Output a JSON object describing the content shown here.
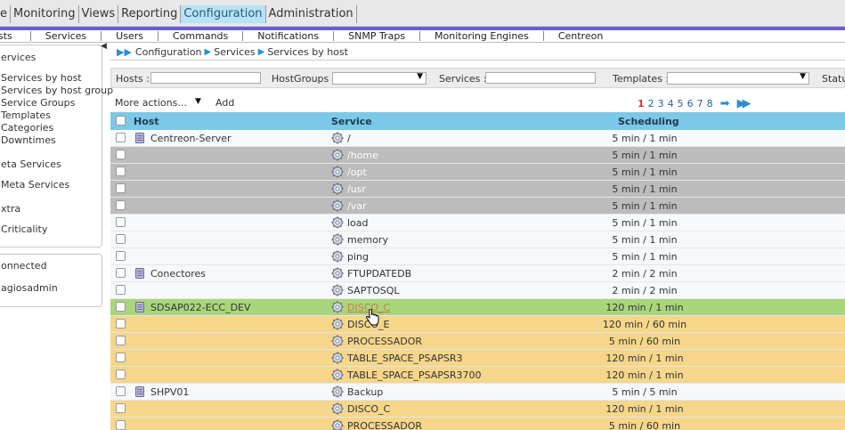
{
  "top_menu": [
    {
      "label": "e"
    },
    {
      "label": "Monitoring"
    },
    {
      "label": "Views"
    },
    {
      "label": "Reporting"
    },
    {
      "label": "Configuration",
      "active": true
    },
    {
      "label": "Administration"
    }
  ],
  "sub_menu": [
    "sts",
    "Services",
    "Users",
    "Commands",
    "Notifications",
    "SNMP Traps",
    "Monitoring Engines",
    "Centreon"
  ],
  "sidebar": {
    "section_title": "ervices",
    "items": [
      "Services by host",
      "Services by host group",
      "Service Groups",
      "Templates",
      "Categories",
      "Downtimes"
    ],
    "meta_title": "eta Services",
    "meta_item": "Meta Services",
    "extra_title": "xtra",
    "extra_item": "Criticality",
    "connected_label": "onnected",
    "user": "agiosadmin"
  },
  "breadcrumb": [
    "Configuration",
    "Services",
    "Services by host"
  ],
  "filters": {
    "hosts_label": "Hosts :",
    "hostgroups_label": "HostGroups :",
    "services_label": "Services :",
    "templates_label": "Templates :",
    "status_label": "Statu"
  },
  "actions": {
    "more_actions": "More actions...",
    "add": "Add"
  },
  "pager": {
    "pages": [
      "1",
      "2",
      "3",
      "4",
      "5",
      "6",
      "7",
      "8"
    ],
    "current": "1"
  },
  "table": {
    "headers": {
      "host": "Host",
      "service": "Service",
      "scheduling": "Scheduling"
    },
    "rows": [
      {
        "host": "Centreon-Server",
        "service": "/",
        "scheduling": "5 min / 1 min",
        "color": "white"
      },
      {
        "host": "",
        "service": "/home",
        "scheduling": "5 min / 1 min",
        "color": "gray"
      },
      {
        "host": "",
        "service": "/opt",
        "scheduling": "5 min / 1 min",
        "color": "gray"
      },
      {
        "host": "",
        "service": "/usr",
        "scheduling": "5 min / 1 min",
        "color": "gray"
      },
      {
        "host": "",
        "service": "/var",
        "scheduling": "5 min / 1 min",
        "color": "gray"
      },
      {
        "host": "",
        "service": "load",
        "scheduling": "5 min / 1 min",
        "color": "white"
      },
      {
        "host": "",
        "service": "memory",
        "scheduling": "5 min / 1 min",
        "color": "white"
      },
      {
        "host": "",
        "service": "ping",
        "scheduling": "5 min / 1 min",
        "color": "white"
      },
      {
        "host": "Conectores",
        "service": "FTUPDATEDB",
        "scheduling": "2 min / 2 min",
        "color": "white"
      },
      {
        "host": "",
        "service": "SAPTOSQL",
        "scheduling": "2 min / 2 min",
        "color": "white"
      },
      {
        "host": "SDSAP022-ECC_DEV",
        "service": "DISCO_C",
        "scheduling": "120 min / 1 min",
        "color": "green",
        "hovered": true
      },
      {
        "host": "",
        "service": "DISCO_E",
        "scheduling": "120 min / 60 min",
        "color": "yellow"
      },
      {
        "host": "",
        "service": "PROCESSADOR",
        "scheduling": "5 min / 60 min",
        "color": "yellow"
      },
      {
        "host": "",
        "service": "TABLE_SPACE_PSAPSR3",
        "scheduling": "120 min / 1 min",
        "color": "yellow"
      },
      {
        "host": "",
        "service": "TABLE_SPACE_PSAPSR3700",
        "scheduling": "120 min / 1 min",
        "color": "yellow"
      },
      {
        "host": "SHPV01",
        "service": "Backup",
        "scheduling": "5 min / 5 min",
        "color": "white"
      },
      {
        "host": "",
        "service": "DISCO_C",
        "scheduling": "120 min / 1 min",
        "color": "yellow"
      },
      {
        "host": "",
        "service": "PROCESSADOR",
        "scheduling": "5 min / 60 min",
        "color": "yellow"
      }
    ]
  },
  "colors": {
    "accent": "#7cc8e8",
    "menu_active": "#b9e2f4",
    "purple_bar": "#6c5fcf",
    "row_gray": "#bcbcbc",
    "row_green": "#a9d67b",
    "row_yellow": "#f5d68a"
  }
}
